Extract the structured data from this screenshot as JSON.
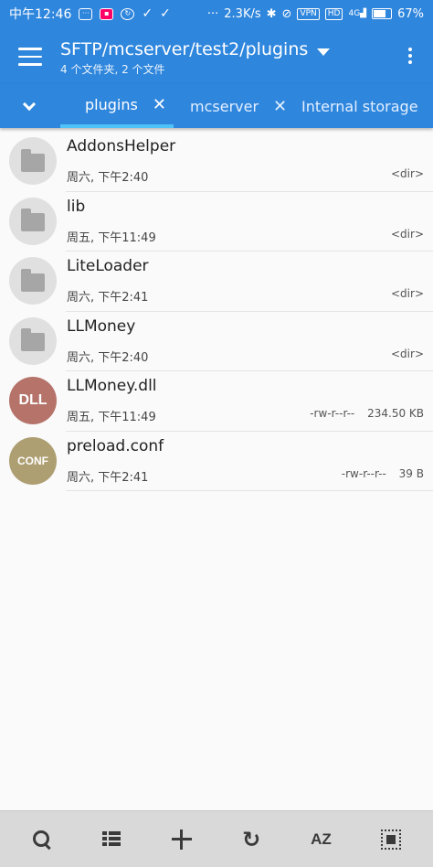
{
  "status_bar": {
    "time": "中午12:46",
    "indicators": [
      "chat-icon",
      "notification-icon",
      "sync-icon",
      "check-icon",
      "check-icon"
    ],
    "more": "···",
    "net_speed": "2.3K/s",
    "vpn": "VPN",
    "hd": "HD",
    "signal_label": "4G",
    "battery": "67%"
  },
  "app_bar": {
    "title": "SFTP/mcserver/test2/plugins",
    "subtitle": "4 个文件夹, 2 个文件"
  },
  "tabs": [
    {
      "label": "plugins",
      "active": true
    },
    {
      "label": "mcserver",
      "active": false
    },
    {
      "label": "Internal storage",
      "active": false
    }
  ],
  "files": [
    {
      "name": "AddonsHelper",
      "date": "周六, 下午2:40",
      "type": "folder",
      "size": "<dir>",
      "perm": ""
    },
    {
      "name": "lib",
      "date": "周五, 下午11:49",
      "type": "folder",
      "size": "<dir>",
      "perm": ""
    },
    {
      "name": "LiteLoader",
      "date": "周六, 下午2:41",
      "type": "folder",
      "size": "<dir>",
      "perm": ""
    },
    {
      "name": "LLMoney",
      "date": "周六, 下午2:40",
      "type": "folder",
      "size": "<dir>",
      "perm": ""
    },
    {
      "name": "LLMoney.dll",
      "date": "周五, 下午11:49",
      "type": "file",
      "badge": "DLL",
      "badge_color": "#b5736a",
      "perm": "-rw-r--r--",
      "size": "234.50 KB"
    },
    {
      "name": "preload.conf",
      "date": "周六, 下午2:41",
      "type": "file",
      "badge": "CONF",
      "badge_color": "#ad9f72",
      "perm": "-rw-r--r--",
      "size": "39 B"
    }
  ],
  "bottom_bar": {
    "search": "search-icon",
    "view": "list-view-icon",
    "add": "add-icon",
    "refresh": "refresh-icon",
    "sort_label": "AZ",
    "select": "select-all-icon"
  },
  "colors": {
    "primary": "#2f86dd",
    "tab_indicator": "#4fc3f7"
  }
}
